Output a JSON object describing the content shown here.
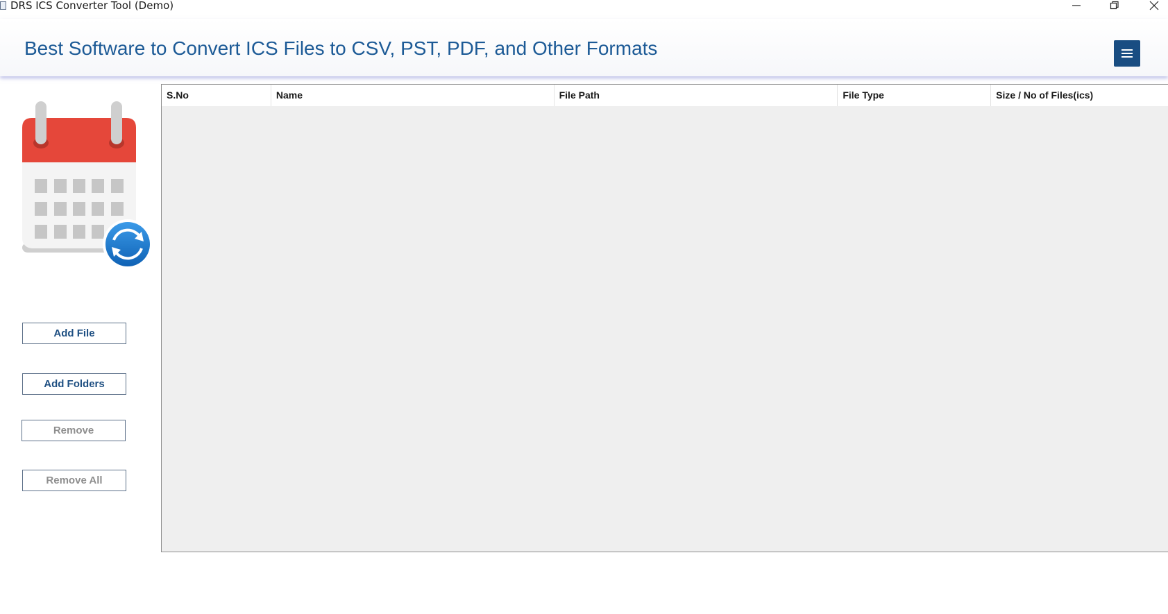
{
  "window": {
    "title": "DRS ICS Converter Tool (Demo)"
  },
  "header": {
    "title": "Best Software to Convert ICS Files to CSV, PST, PDF, and Other Formats",
    "menu_icon": "hamburger-menu-icon"
  },
  "sidebar": {
    "illustration": "calendar-sync-icon",
    "buttons": [
      {
        "label": "Add File",
        "enabled": true
      },
      {
        "label": "Add Folders",
        "enabled": true
      },
      {
        "label": "Remove",
        "enabled": false
      },
      {
        "label": "Remove All",
        "enabled": false
      }
    ]
  },
  "table": {
    "columns": [
      "S.No",
      "Name",
      "File Path",
      "File Type",
      "Size / No of Files(ics)"
    ],
    "rows": []
  },
  "colors": {
    "accent": "#1c5a96",
    "menu_button": "#194d82",
    "calendar_red": "#e5473a",
    "sync_blue": "#1a78d0",
    "grid_background": "#efefef"
  }
}
